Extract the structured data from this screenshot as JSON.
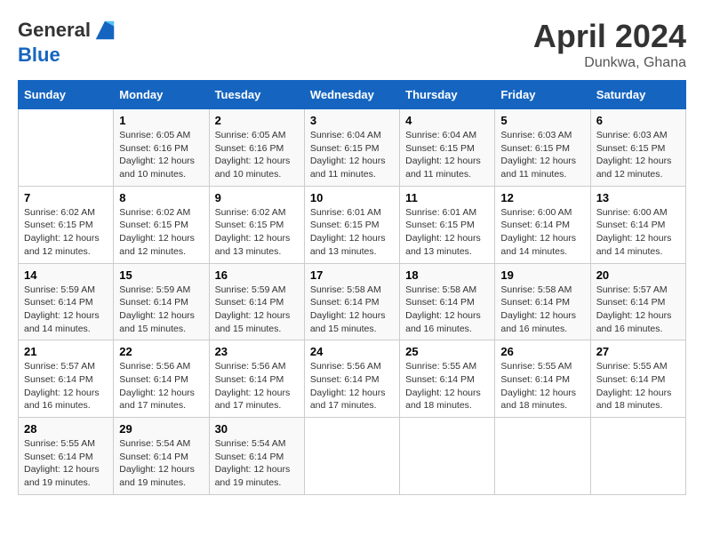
{
  "header": {
    "logo_line1": "General",
    "logo_line2": "Blue",
    "month_year": "April 2024",
    "location": "Dunkwa, Ghana"
  },
  "columns": [
    "Sunday",
    "Monday",
    "Tuesday",
    "Wednesday",
    "Thursday",
    "Friday",
    "Saturday"
  ],
  "weeks": [
    [
      {
        "day": "",
        "info": ""
      },
      {
        "day": "1",
        "info": "Sunrise: 6:05 AM\nSunset: 6:16 PM\nDaylight: 12 hours\nand 10 minutes."
      },
      {
        "day": "2",
        "info": "Sunrise: 6:05 AM\nSunset: 6:16 PM\nDaylight: 12 hours\nand 10 minutes."
      },
      {
        "day": "3",
        "info": "Sunrise: 6:04 AM\nSunset: 6:15 PM\nDaylight: 12 hours\nand 11 minutes."
      },
      {
        "day": "4",
        "info": "Sunrise: 6:04 AM\nSunset: 6:15 PM\nDaylight: 12 hours\nand 11 minutes."
      },
      {
        "day": "5",
        "info": "Sunrise: 6:03 AM\nSunset: 6:15 PM\nDaylight: 12 hours\nand 11 minutes."
      },
      {
        "day": "6",
        "info": "Sunrise: 6:03 AM\nSunset: 6:15 PM\nDaylight: 12 hours\nand 12 minutes."
      }
    ],
    [
      {
        "day": "7",
        "info": "Sunrise: 6:02 AM\nSunset: 6:15 PM\nDaylight: 12 hours\nand 12 minutes."
      },
      {
        "day": "8",
        "info": "Sunrise: 6:02 AM\nSunset: 6:15 PM\nDaylight: 12 hours\nand 12 minutes."
      },
      {
        "day": "9",
        "info": "Sunrise: 6:02 AM\nSunset: 6:15 PM\nDaylight: 12 hours\nand 13 minutes."
      },
      {
        "day": "10",
        "info": "Sunrise: 6:01 AM\nSunset: 6:15 PM\nDaylight: 12 hours\nand 13 minutes."
      },
      {
        "day": "11",
        "info": "Sunrise: 6:01 AM\nSunset: 6:15 PM\nDaylight: 12 hours\nand 13 minutes."
      },
      {
        "day": "12",
        "info": "Sunrise: 6:00 AM\nSunset: 6:14 PM\nDaylight: 12 hours\nand 14 minutes."
      },
      {
        "day": "13",
        "info": "Sunrise: 6:00 AM\nSunset: 6:14 PM\nDaylight: 12 hours\nand 14 minutes."
      }
    ],
    [
      {
        "day": "14",
        "info": "Sunrise: 5:59 AM\nSunset: 6:14 PM\nDaylight: 12 hours\nand 14 minutes."
      },
      {
        "day": "15",
        "info": "Sunrise: 5:59 AM\nSunset: 6:14 PM\nDaylight: 12 hours\nand 15 minutes."
      },
      {
        "day": "16",
        "info": "Sunrise: 5:59 AM\nSunset: 6:14 PM\nDaylight: 12 hours\nand 15 minutes."
      },
      {
        "day": "17",
        "info": "Sunrise: 5:58 AM\nSunset: 6:14 PM\nDaylight: 12 hours\nand 15 minutes."
      },
      {
        "day": "18",
        "info": "Sunrise: 5:58 AM\nSunset: 6:14 PM\nDaylight: 12 hours\nand 16 minutes."
      },
      {
        "day": "19",
        "info": "Sunrise: 5:58 AM\nSunset: 6:14 PM\nDaylight: 12 hours\nand 16 minutes."
      },
      {
        "day": "20",
        "info": "Sunrise: 5:57 AM\nSunset: 6:14 PM\nDaylight: 12 hours\nand 16 minutes."
      }
    ],
    [
      {
        "day": "21",
        "info": "Sunrise: 5:57 AM\nSunset: 6:14 PM\nDaylight: 12 hours\nand 16 minutes."
      },
      {
        "day": "22",
        "info": "Sunrise: 5:56 AM\nSunset: 6:14 PM\nDaylight: 12 hours\nand 17 minutes."
      },
      {
        "day": "23",
        "info": "Sunrise: 5:56 AM\nSunset: 6:14 PM\nDaylight: 12 hours\nand 17 minutes."
      },
      {
        "day": "24",
        "info": "Sunrise: 5:56 AM\nSunset: 6:14 PM\nDaylight: 12 hours\nand 17 minutes."
      },
      {
        "day": "25",
        "info": "Sunrise: 5:55 AM\nSunset: 6:14 PM\nDaylight: 12 hours\nand 18 minutes."
      },
      {
        "day": "26",
        "info": "Sunrise: 5:55 AM\nSunset: 6:14 PM\nDaylight: 12 hours\nand 18 minutes."
      },
      {
        "day": "27",
        "info": "Sunrise: 5:55 AM\nSunset: 6:14 PM\nDaylight: 12 hours\nand 18 minutes."
      }
    ],
    [
      {
        "day": "28",
        "info": "Sunrise: 5:55 AM\nSunset: 6:14 PM\nDaylight: 12 hours\nand 19 minutes."
      },
      {
        "day": "29",
        "info": "Sunrise: 5:54 AM\nSunset: 6:14 PM\nDaylight: 12 hours\nand 19 minutes."
      },
      {
        "day": "30",
        "info": "Sunrise: 5:54 AM\nSunset: 6:14 PM\nDaylight: 12 hours\nand 19 minutes."
      },
      {
        "day": "",
        "info": ""
      },
      {
        "day": "",
        "info": ""
      },
      {
        "day": "",
        "info": ""
      },
      {
        "day": "",
        "info": ""
      }
    ]
  ]
}
